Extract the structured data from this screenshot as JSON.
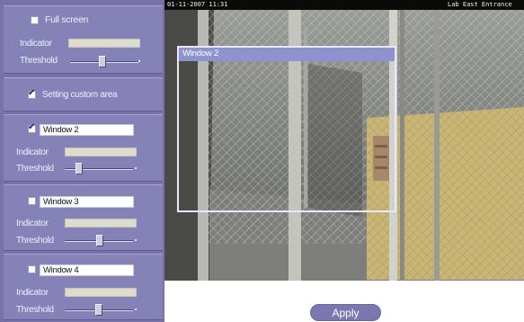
{
  "panel": {
    "full_screen": {
      "checked": false,
      "label": "Full screen",
      "indicator_label": "Indicator",
      "threshold_label": "Threshold"
    },
    "custom_area": {
      "checked": true,
      "label": "Setting custom area"
    },
    "windows": [
      {
        "checked": true,
        "name": "Window 2",
        "indicator_label": "Indicator",
        "threshold_label": "Threshold"
      },
      {
        "checked": false,
        "name": "Window 3",
        "indicator_label": "Indicator",
        "threshold_label": "Threshold"
      },
      {
        "checked": false,
        "name": "Window 4",
        "indicator_label": "Indicator",
        "threshold_label": "Threshold"
      }
    ]
  },
  "camera": {
    "timestamp": "01-11-2007 11:31",
    "camera_name": "Lab East Entrance",
    "detection_window_title": "Window 2"
  },
  "actions": {
    "apply_label": "Apply"
  },
  "colors": {
    "panel_bg": "#7773aa",
    "group_bg": "#8582b8",
    "window_title_bg": "#8c93cf",
    "button_bg": "#7b78b0"
  }
}
